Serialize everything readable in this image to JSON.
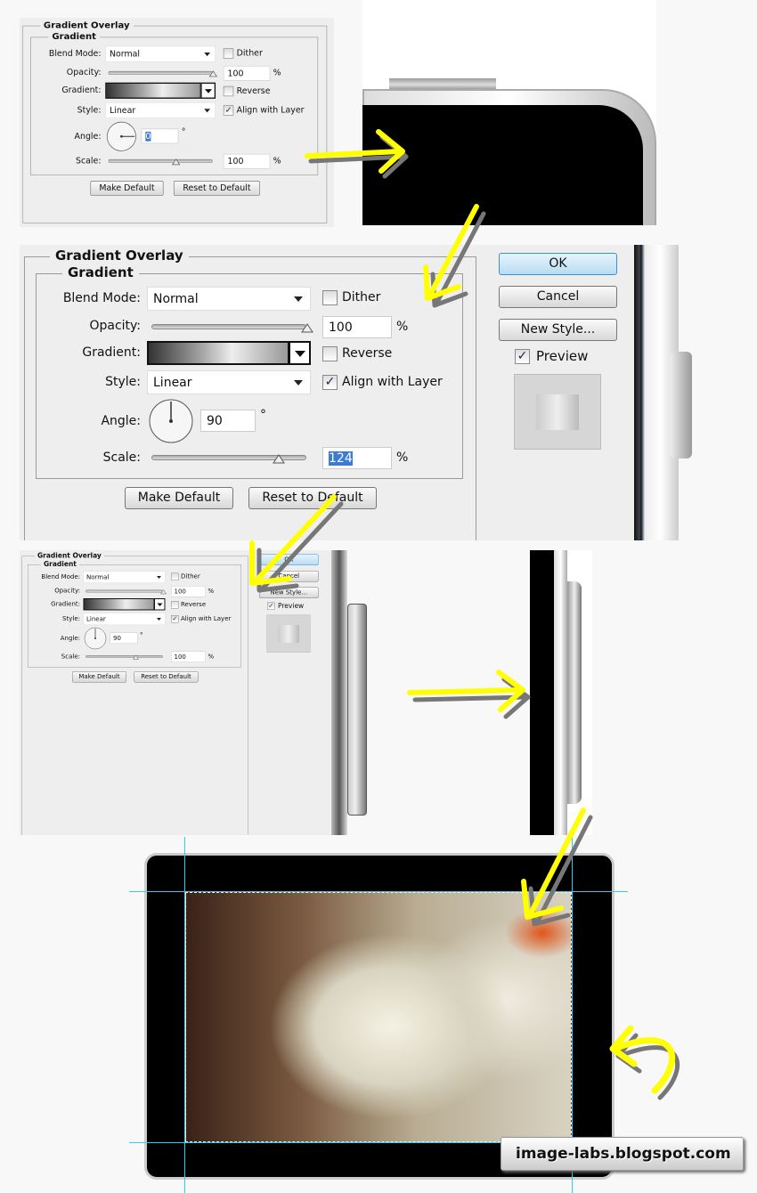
{
  "panels": [
    {
      "title": "Gradient Overlay",
      "group": "Gradient",
      "blend_label": "Blend Mode:",
      "blend_value": "Normal",
      "dither": "Dither",
      "opacity_label": "Opacity:",
      "opacity": "100",
      "pct": "%",
      "gradient_label": "Gradient:",
      "reverse": "Reverse",
      "style_label": "Style:",
      "style_value": "Linear",
      "align": "Align with Layer",
      "angle_label": "Angle:",
      "angle": "0",
      "deg": "°",
      "scale_label": "Scale:",
      "scale": "100",
      "make_default": "Make Default",
      "reset_default": "Reset to Default",
      "dither_checked": false,
      "reverse_checked": false,
      "align_checked": true
    },
    {
      "title": "Gradient Overlay",
      "group": "Gradient",
      "blend_label": "Blend Mode:",
      "blend_value": "Normal",
      "dither": "Dither",
      "opacity_label": "Opacity:",
      "opacity": "100",
      "pct": "%",
      "gradient_label": "Gradient:",
      "reverse": "Reverse",
      "style_label": "Style:",
      "style_value": "Linear",
      "align": "Align with Layer",
      "angle_label": "Angle:",
      "angle": "90",
      "deg": "°",
      "scale_label": "Scale:",
      "scale": "124",
      "make_default": "Make Default",
      "reset_default": "Reset to Default",
      "dither_checked": false,
      "reverse_checked": false,
      "align_checked": true
    },
    {
      "title": "Gradient Overlay",
      "group": "Gradient",
      "blend_label": "Blend Mode:",
      "blend_value": "Normal",
      "dither": "Dither",
      "opacity_label": "Opacity:",
      "opacity": "100",
      "pct": "%",
      "gradient_label": "Gradient:",
      "reverse": "Reverse",
      "style_label": "Style:",
      "style_value": "Linear",
      "align": "Align with Layer",
      "angle_label": "Angle:",
      "angle": "90",
      "deg": "°",
      "scale_label": "Scale:",
      "scale": "100",
      "make_default": "Make Default",
      "reset_default": "Reset to Default",
      "dither_checked": false,
      "reverse_checked": false,
      "align_checked": true
    }
  ],
  "buttons": {
    "ok": "OK",
    "cancel": "Cancel",
    "new_style": "New Style...",
    "preview": "Preview",
    "preview_checked": true
  },
  "watermark": "image-labs.blogspot.com",
  "colors": {
    "arrow": "#ffff00",
    "guide": "#33ccee",
    "phone": "#000000"
  }
}
